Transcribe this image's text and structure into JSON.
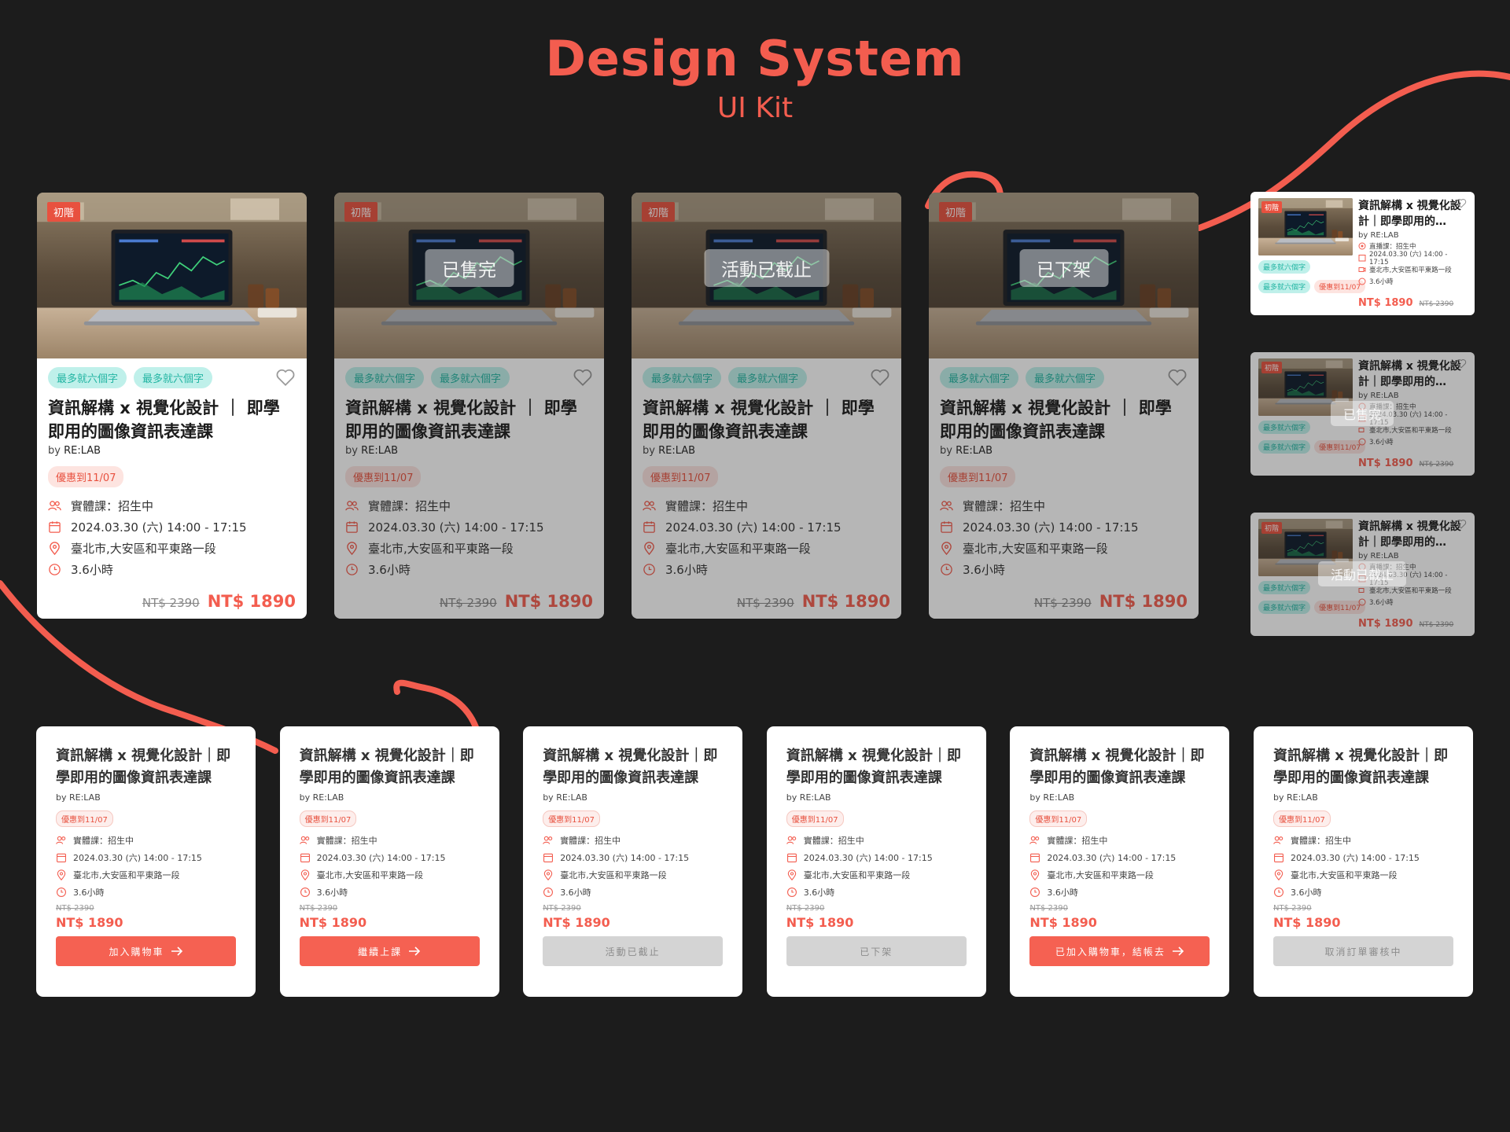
{
  "header": {
    "title": "Design System",
    "subtitle": "UI Kit"
  },
  "course": {
    "level": "初階",
    "tags": [
      "最多就六個字",
      "最多就六個字"
    ],
    "title": "資訊解構 x 視覺化設計 ｜ 即學即用的圖像資訊表達課",
    "title_small": "資訊解構 x 視覺化設計｜即學即用的…",
    "title_bottom": "資訊解構 x 視覺化設計｜即學即用的圖像資訊表達課",
    "by_prefix": "by",
    "author": "RE:LAB",
    "promo": "優惠到11/07",
    "type": "實體課：招生中",
    "type_live": "直播課：招生中",
    "datetime": "2024.03.30 (六) 14:00 - 17:15",
    "location": "臺北市,大安區和平東路一段",
    "duration": "3.6小時",
    "original_price": "NT$ 2390",
    "price": "NT$ 1890"
  },
  "statuses": {
    "sold_out": "已售完",
    "ended": "活動已截止",
    "removed": "已下架"
  },
  "buttons": {
    "add_cart": "加入購物車",
    "continue": "繼續上課",
    "ended": "活動已截止",
    "removed": "已下架",
    "in_cart": "已加入購物車，結帳去",
    "cancel_review": "取消訂單審核中"
  },
  "colors": {
    "accent": "#f35d4f",
    "tag_bg": "#bff0ea",
    "tag_text": "#23b5a3",
    "background": "#1c1c1c",
    "disabled": "#d4d4d4"
  }
}
